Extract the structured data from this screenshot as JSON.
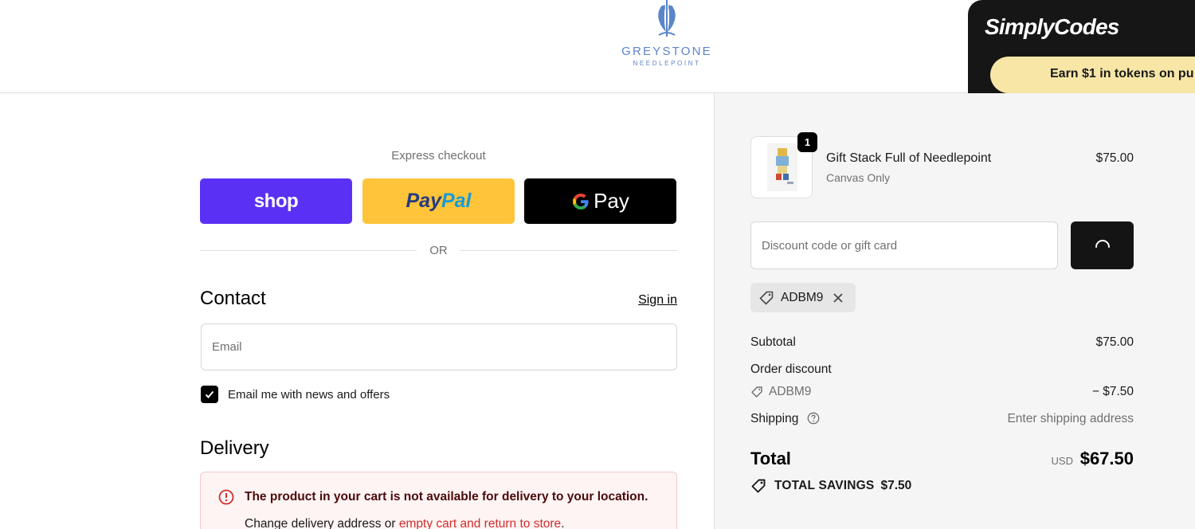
{
  "header": {
    "logo_name": "GREYSTONE",
    "logo_sub": "NEEDLEPOINT",
    "extension": {
      "brand": "SimplyCodes",
      "promo": "Earn $1 in tokens on pu"
    }
  },
  "checkout": {
    "express_label": "Express checkout",
    "shop_label": "shop",
    "paypal_part1": "Pay",
    "paypal_part2": "Pal",
    "gpay_label": "Pay",
    "or_label": "OR",
    "contact_title": "Contact",
    "signin_label": "Sign in",
    "email_placeholder": "Email",
    "newsletter_label": "Email me with news and offers",
    "newsletter_checked": true,
    "delivery_title": "Delivery",
    "error_title": "The product in your cart is not available for delivery to your location.",
    "error_sub_prefix": "Change delivery address or ",
    "error_sub_link": "empty cart and return to store",
    "error_sub_suffix": "."
  },
  "summary": {
    "item": {
      "quantity": "1",
      "name": "Gift Stack Full of Needlepoint",
      "variant": "Canvas Only",
      "price": "$75.00"
    },
    "discount_placeholder": "Discount code or gift card",
    "applied_code": "ADBM9",
    "subtotal_label": "Subtotal",
    "subtotal_value": "$75.00",
    "order_discount_label": "Order discount",
    "discount_code": "ADBM9",
    "discount_value": "− $7.50",
    "shipping_label": "Shipping",
    "shipping_value": "Enter shipping address",
    "total_label": "Total",
    "total_currency": "USD",
    "total_value": "$67.50",
    "savings_label": "TOTAL SAVINGS",
    "savings_value": "$7.50"
  },
  "colors": {
    "shop_purple": "#5a31f4",
    "paypal_yellow": "#ffc439",
    "gpay_black": "#000000",
    "logo_blue": "#5b85c8",
    "error_red": "#d12e2e"
  }
}
